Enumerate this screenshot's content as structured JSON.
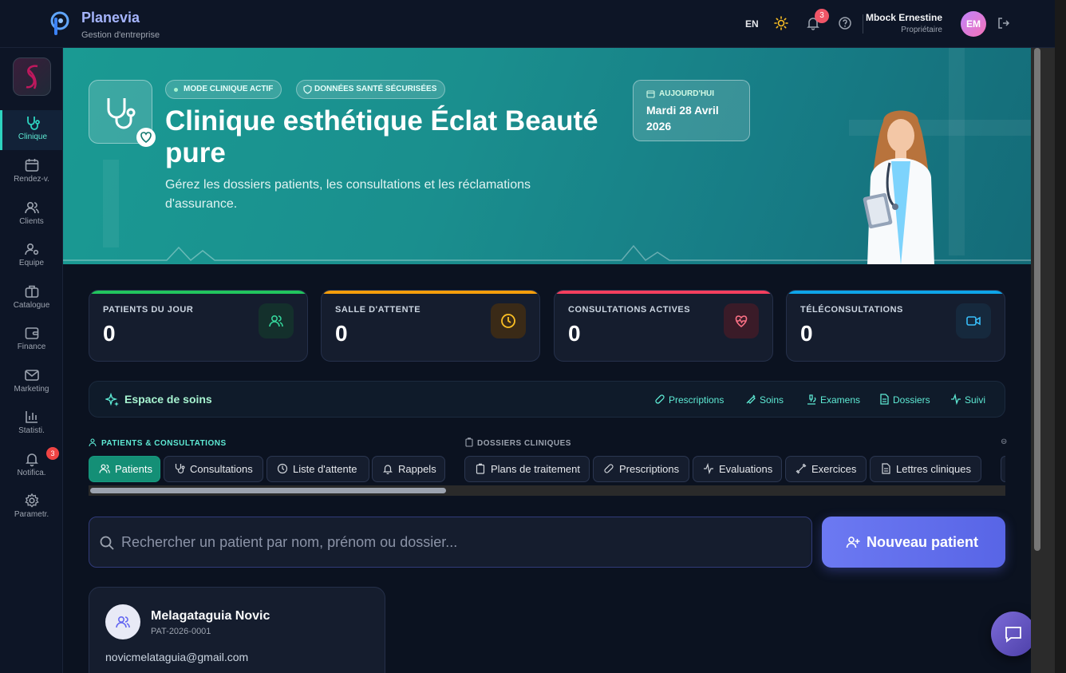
{
  "app": {
    "name": "Planevia",
    "subtitle": "Gestion d'entreprise"
  },
  "topbar": {
    "lang": "EN",
    "notifications_count": "3",
    "user_name": "Mbock Ernestine",
    "user_role": "Propriétaire",
    "avatar_initials": "EM"
  },
  "sidebar": {
    "items": [
      {
        "label": "Clinique",
        "icon": "stethoscope-icon",
        "active": true
      },
      {
        "label": "Rendez-v.",
        "icon": "calendar-icon"
      },
      {
        "label": "Clients",
        "icon": "users-icon"
      },
      {
        "label": "Equipe",
        "icon": "user-cog-icon"
      },
      {
        "label": "Catalogue",
        "icon": "briefcase-icon"
      },
      {
        "label": "Finance",
        "icon": "wallet-icon"
      },
      {
        "label": "Marketing",
        "icon": "mail-icon"
      },
      {
        "label": "Statisti.",
        "icon": "bar-chart-icon"
      },
      {
        "label": "Notifica.",
        "icon": "bell-icon",
        "badge": "3"
      },
      {
        "label": "Parametr.",
        "icon": "gear-icon"
      }
    ]
  },
  "hero": {
    "pill_mode": "MODE CLINIQUE ACTIF",
    "pill_secure": "DONNÉES SANTÉ SÉCURISÉES",
    "title": "Clinique esthétique Éclat Beauté pure",
    "description": "Gérez les dossiers patients, les consultations et les réclamations d'assurance.",
    "date_label": "AUJOURD'HUI",
    "date_value": "Mardi 28 Avril 2026"
  },
  "stats": [
    {
      "label": "PATIENTS DU JOUR",
      "value": "0",
      "color": "#22c55e",
      "icon": "users-icon"
    },
    {
      "label": "SALLE D'ATTENTE",
      "value": "0",
      "color": "#f59e0b",
      "icon": "clock-icon"
    },
    {
      "label": "CONSULTATIONS ACTIVES",
      "value": "0",
      "color": "#f43f5e",
      "icon": "heart-pulse-icon"
    },
    {
      "label": "TÉLÉCONSULTATIONS",
      "value": "0",
      "color": "#0ea5e9",
      "icon": "video-icon"
    }
  ],
  "care": {
    "title": "Espace de soins",
    "links": [
      "Prescriptions",
      "Soins",
      "Examens",
      "Dossiers",
      "Suivi"
    ]
  },
  "sections": {
    "patients_label": "PATIENTS & CONSULTATIONS",
    "dossiers_label": "DOSSIERS CLINIQUES",
    "patients_tabs": [
      "Patients",
      "Consultations",
      "Liste d'attente",
      "Rappels"
    ],
    "dossiers_tabs": [
      "Plans de traitement",
      "Prescriptions",
      "Evaluations",
      "Exercices",
      "Lettres cliniques"
    ]
  },
  "search": {
    "placeholder": "Rechercher un patient par nom, prénom ou dossier...",
    "value": ""
  },
  "new_patient_label": "Nouveau patient",
  "patients": [
    {
      "name": "Melagataguia Novic",
      "id": "PAT-2026-0001",
      "email": "novicmelataguia@gmail.com"
    }
  ]
}
